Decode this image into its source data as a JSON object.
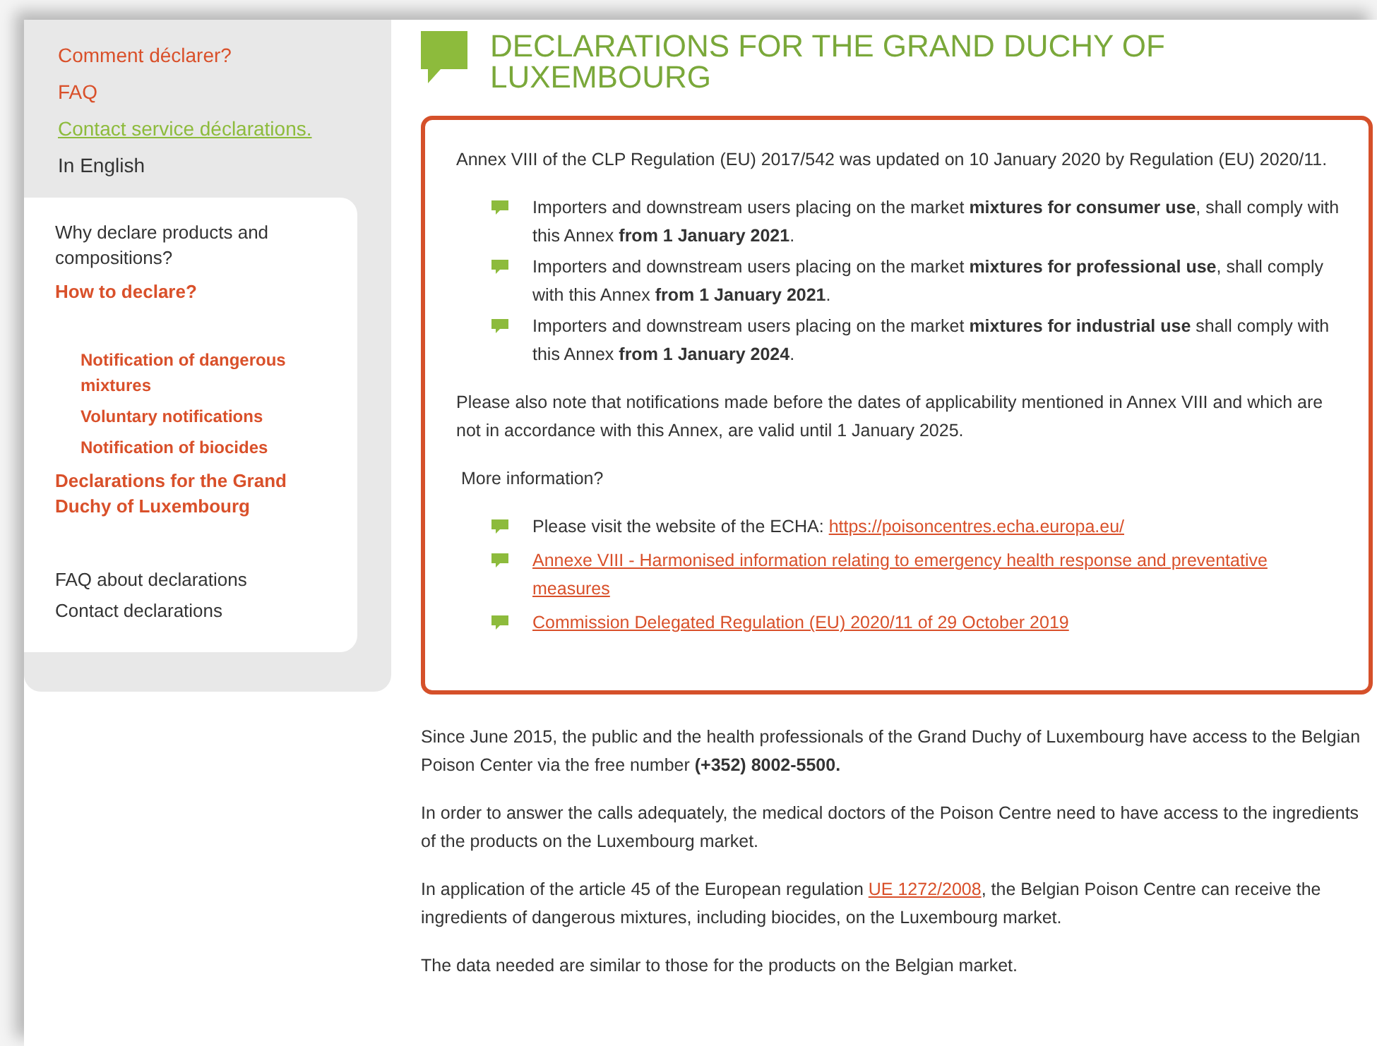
{
  "sidebar": {
    "top_links": [
      {
        "label": "Comment déclarer?",
        "kind": "link"
      },
      {
        "label": "FAQ",
        "kind": "link"
      },
      {
        "label": "Contact service déclarations.",
        "kind": "contact"
      },
      {
        "label": "In English",
        "kind": "current"
      }
    ],
    "nav": [
      {
        "label": "Why declare products and compositions?",
        "selected": false
      },
      {
        "label": "How to declare?",
        "selected": true,
        "children": [
          {
            "label": "Notification of dangerous mixtures",
            "selected": true
          },
          {
            "label": "Voluntary notifications",
            "selected": true
          },
          {
            "label": "Notification of biocides",
            "selected": true
          }
        ]
      },
      {
        "label": "Declarations for the Grand Duchy of Luxembourg",
        "selected": true
      }
    ],
    "nav_secondary": [
      {
        "label": "FAQ about declarations",
        "selected": false
      },
      {
        "label": "Contact declarations",
        "selected": false
      }
    ]
  },
  "title": "DECLARATIONS FOR THE GRAND DUCHY OF LUXEMBOURG",
  "notice": {
    "intro": " Annex VIII of the CLP Regulation (EU) 2017/542 was updated on 10 January 2020 by Regulation (EU) 2020/11.",
    "bullets": [
      "Importers and downstream users placing on the market **mixtures for consumer use**, shall comply with this Annex **from 1 January 2021**.",
      "Importers and downstream users placing on the market **mixtures for professional use**, shall comply with this Annex **from 1 January 2021**.",
      "Importers and downstream users placing on the market **mixtures for industrial use** shall comply with this Annex **from 1 January 2024**."
    ],
    "note": "Please also note that notifications made before the dates of applicability mentioned in Annex VIII and which are not in accordance with this Annex, are valid until 1 January 2025.",
    "more_heading": " More information?",
    "links": [
      {
        "kind": "text-with-link",
        "text": "Please visit the website of the ECHA: ",
        "link": "https://poisoncentres.echa.europa.eu/"
      },
      {
        "kind": "link",
        "link": "Annexe VIII - Harmonised information relating to emergency health response and preventative measures"
      },
      {
        "kind": "link",
        "link": "Commission Delegated Regulation (EU) 2020/11 of 29 October 2019"
      }
    ]
  },
  "paragraphs": [
    {
      "text": "Since June 2015, the public and the health professionals of the Grand Duchy of Luxembourg have access to the Belgian Poison Center via the free number **(+352) 8002-5500.**"
    },
    {
      "text": "In order to answer the calls adequately, the medical doctors of the Poison Centre need to have access to the ingredients of the products on the Luxembourg market."
    },
    {
      "text": "In application of the article 45 of the European regulation ",
      "link": "UE 1272/2008",
      "after": ", the Belgian Poison Centre can receive the ingredients of dangerous mixtures, including biocides, on the Luxembourg market."
    },
    {
      "text": "The data needed are similar to those for the products on the Belgian market."
    }
  ]
}
